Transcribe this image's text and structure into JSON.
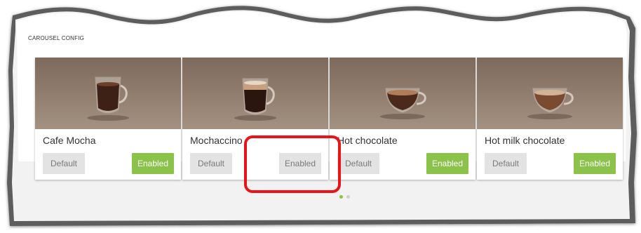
{
  "panel": {
    "label": "CAROUSEL CONFIG"
  },
  "cards": [
    {
      "title": "Cafe Mocha",
      "default_label": "Default",
      "enabled_label": "Enabled",
      "enabled_active": true
    },
    {
      "title": "Mochaccino",
      "default_label": "Default",
      "enabled_label": "Enabled",
      "enabled_active": false
    },
    {
      "title": "Hot chocolate",
      "default_label": "Default",
      "enabled_label": "Enabled",
      "enabled_active": true
    },
    {
      "title": "Hot milk chocolate",
      "default_label": "Default",
      "enabled_label": "Enabled",
      "enabled_active": true
    }
  ],
  "pagination": {
    "pages": 2,
    "current": 1
  },
  "colors": {
    "enabled_green": "#8bc34a",
    "default_gray": "#e3e3e3",
    "highlight_red": "#e8141a",
    "image_brown": "#8e7b6c"
  },
  "icons": {
    "product_image": "coffee-cup-icon"
  }
}
